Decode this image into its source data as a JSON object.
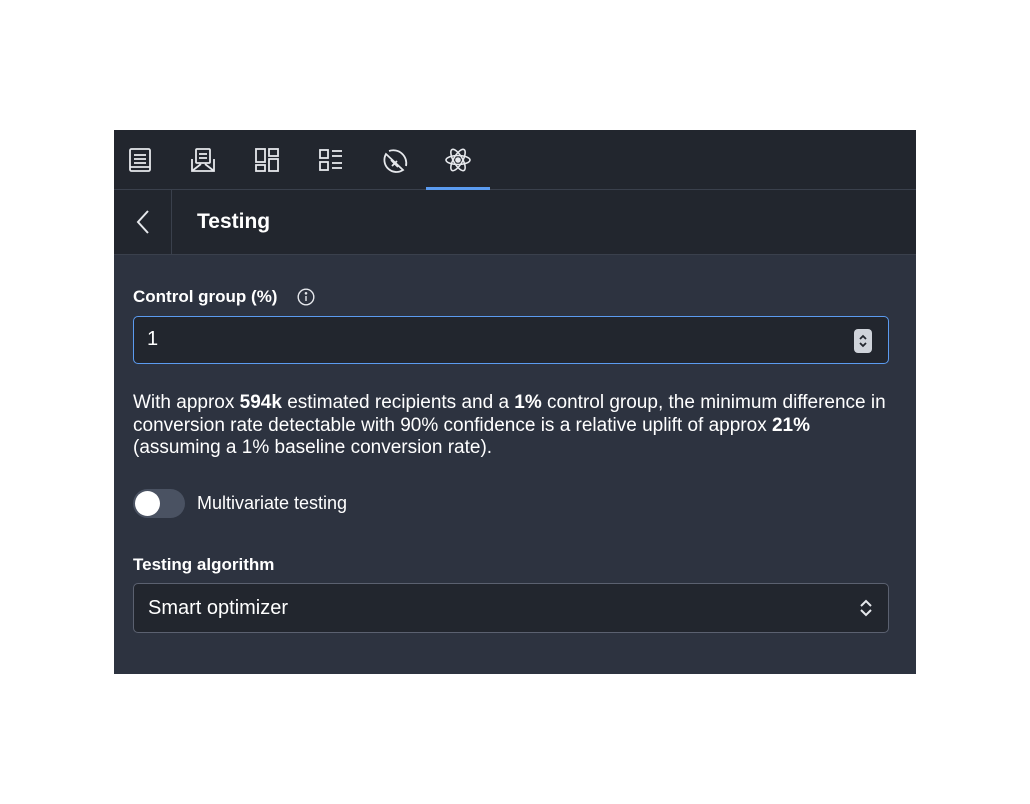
{
  "tabs": [
    {
      "icon": "document-icon",
      "active": false
    },
    {
      "icon": "envelope-icon",
      "active": false
    },
    {
      "icon": "layout-grid-icon",
      "active": false
    },
    {
      "icon": "list-blocks-icon",
      "active": false
    },
    {
      "icon": "pie-segment-icon",
      "active": false
    },
    {
      "icon": "atom-icon",
      "active": true
    }
  ],
  "header": {
    "back_icon": "chevron-left-icon",
    "title": "Testing"
  },
  "control_group": {
    "label": "Control group (%)",
    "info_icon": "info-icon",
    "value": "1"
  },
  "description": {
    "part1": "With approx ",
    "recipients": "594k",
    "part2": " estimated recipients and a ",
    "control_pct": "1%",
    "part3": " control group, the minimum difference in conversion rate detectable with 90% confidence is a relative uplift of approx ",
    "uplift": "21%",
    "part4": " (assuming a 1% baseline conversion rate)."
  },
  "multivariate": {
    "label": "Multivariate testing",
    "enabled": false
  },
  "algorithm": {
    "label": "Testing algorithm",
    "value": "Smart optimizer"
  },
  "colors": {
    "accent": "#5b9bf0",
    "panel_bg": "#2d3340",
    "header_bg": "#22262e"
  }
}
